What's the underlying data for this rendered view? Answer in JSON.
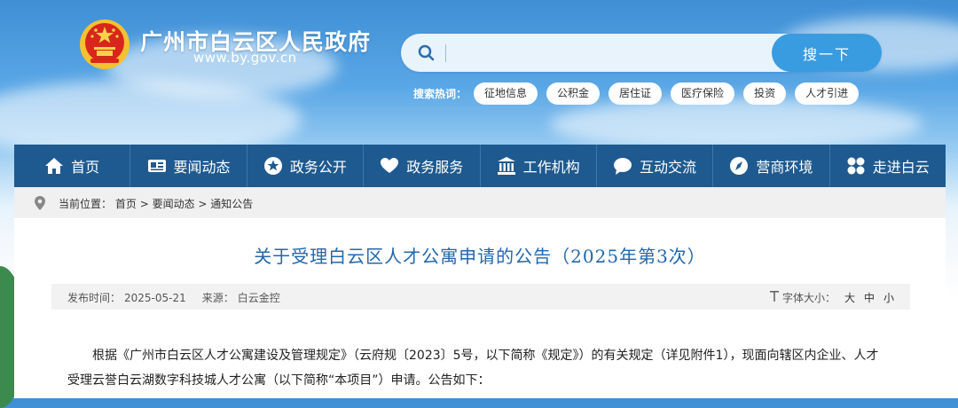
{
  "header": {
    "site_title": "广州市白云区人民政府",
    "site_url": "www.by.gov.cn"
  },
  "search": {
    "placeholder": "",
    "button_label": "搜一下",
    "hot_label": "搜索热词：",
    "hot_tags": [
      "征地信息",
      "公积金",
      "居住证",
      "医疗保险",
      "投资",
      "人才引进"
    ]
  },
  "nav": {
    "items": [
      {
        "label": "首页",
        "icon": "home-icon"
      },
      {
        "label": "要闻动态",
        "icon": "newspaper-icon"
      },
      {
        "label": "政务公开",
        "icon": "star-icon"
      },
      {
        "label": "政务服务",
        "icon": "heart-hand-icon"
      },
      {
        "label": "工作机构",
        "icon": "building-icon"
      },
      {
        "label": "互动交流",
        "icon": "chat-bubble-icon"
      },
      {
        "label": "营商环境",
        "icon": "compass-icon"
      },
      {
        "label": "走进白云",
        "icon": "grid-icon"
      }
    ]
  },
  "breadcrumb": {
    "prefix": "当前位置：",
    "items": [
      "首页",
      "要闻动态",
      "通知公告"
    ],
    "separator": " > "
  },
  "article": {
    "title": "关于受理白云区人才公寓申请的公告（2025年第3次）",
    "publish_label": "发布时间：",
    "publish_date": "2025-05-21",
    "source_label": "来源：",
    "source": "白云金控",
    "font_size_label": "字体大小：",
    "font_sizes": [
      "大",
      "中",
      "小"
    ],
    "paragraph_line1": "根据《广州市白云区人才公寓建设及管理规定》（云府规〔2023〕5号，以下简称《规定》）的有关规定（详见附件1），现面向辖区内企业、人才",
    "paragraph_line2": "受理云誉白云湖数字科技城人才公寓（以下简称“本项目”）申请。公告如下："
  },
  "colors": {
    "nav_bg": "#1e5a8f",
    "title_blue": "#2267ab",
    "search_button": "#3a9ce0"
  }
}
